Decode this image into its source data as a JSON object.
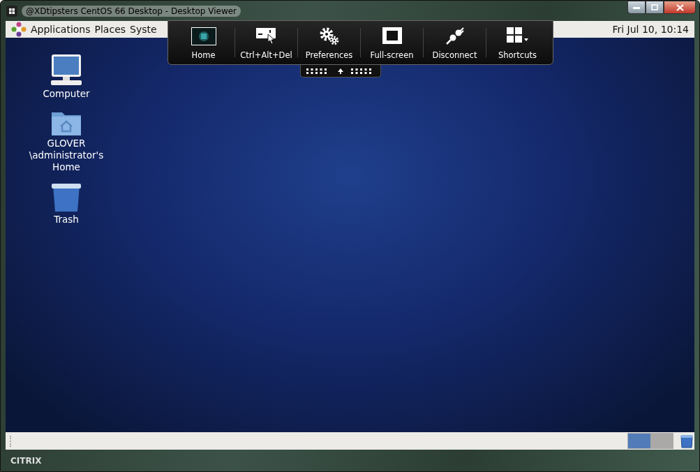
{
  "window": {
    "title": "@XDtipsters CentOS 66 Desktop - Desktop Viewer"
  },
  "top_panel": {
    "menus": [
      "Applications",
      "Places",
      "Syste"
    ],
    "clock": "Fri Jul 10, 10:14"
  },
  "toolbar": {
    "buttons": [
      {
        "kind": "home",
        "label": "Home"
      },
      {
        "kind": "ctrl-alt-del",
        "label": "Ctrl+Alt+Del"
      },
      {
        "kind": "preferences",
        "label": "Preferences"
      },
      {
        "kind": "fullscreen",
        "label": "Full-screen"
      },
      {
        "kind": "disconnect",
        "label": "Disconnect"
      },
      {
        "kind": "shortcuts",
        "label": "Shortcuts"
      }
    ]
  },
  "desktop_icons": [
    {
      "kind": "computer",
      "label": "Computer"
    },
    {
      "kind": "home-folder",
      "label": "GLOVER \\administrator's Home"
    },
    {
      "kind": "trash",
      "label": "Trash"
    }
  ],
  "bottom_panel": {
    "workspaces": [
      {
        "selected": true
      },
      {
        "selected": false
      }
    ]
  },
  "footer": {
    "logo": "CITRIX"
  }
}
